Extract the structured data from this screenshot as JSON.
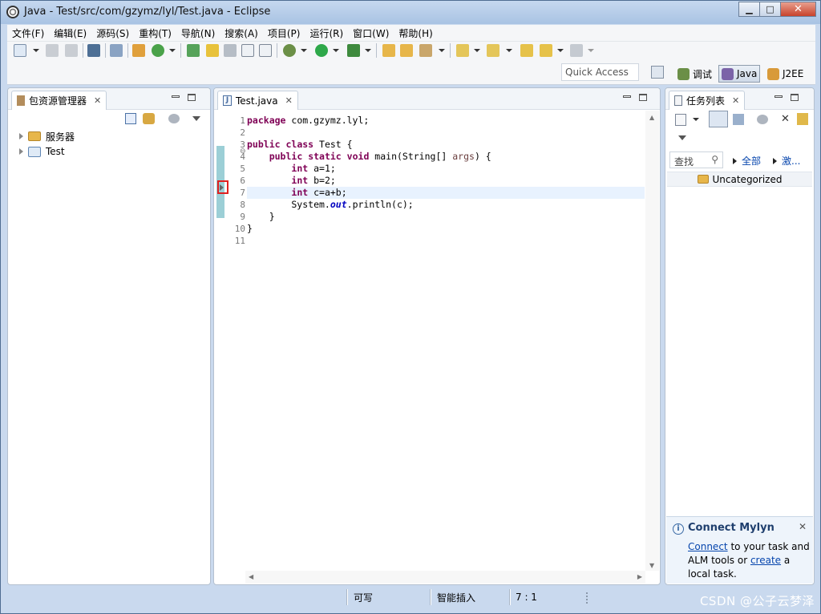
{
  "window": {
    "title": "Java - Test/src/com/gzymz/lyl/Test.java - Eclipse",
    "minimize": "▁",
    "maximize": "□",
    "close": "✕"
  },
  "menu": [
    "文件(F)",
    "编辑(E)",
    "源码(S)",
    "重构(T)",
    "导航(N)",
    "搜索(A)",
    "项目(P)",
    "运行(R)",
    "窗口(W)",
    "帮助(H)"
  ],
  "perspective": {
    "quick_access": "Quick Access",
    "items": [
      {
        "label": "调试",
        "icon": "debug-perspective-icon"
      },
      {
        "label": "Java",
        "icon": "java-perspective-icon",
        "active": true
      },
      {
        "label": "J2EE",
        "icon": "j2ee-perspective-icon"
      }
    ]
  },
  "package_explorer": {
    "tab_label": "包资源管理器",
    "close": "✕",
    "items": [
      {
        "label": "服务器",
        "icon": "folder-icon"
      },
      {
        "label": "Test",
        "icon": "project-icon"
      }
    ]
  },
  "editor": {
    "tab_label": "Test.java",
    "close": "✕",
    "line_numbers": [
      "1",
      "2",
      "3",
      "4",
      "5",
      "6",
      "7",
      "8",
      "9",
      "10",
      "11"
    ],
    "current_line": 7,
    "fold_marker": "⊖",
    "lines": [
      [],
      [
        {
          "t": "package",
          "c": "kw"
        },
        {
          "t": " com.gzymz.lyl;",
          "c": ""
        }
      ],
      [],
      [
        {
          "t": "public",
          "c": "kw"
        },
        {
          "t": " ",
          "c": ""
        },
        {
          "t": "class",
          "c": "kw"
        },
        {
          "t": " Test {",
          "c": ""
        }
      ],
      [
        {
          "t": "    ",
          "c": ""
        },
        {
          "t": "public",
          "c": "kw"
        },
        {
          "t": " ",
          "c": ""
        },
        {
          "t": "static",
          "c": "kw"
        },
        {
          "t": " ",
          "c": ""
        },
        {
          "t": "void",
          "c": "kw"
        },
        {
          "t": " main(String[] ",
          "c": ""
        },
        {
          "t": "args",
          "c": "param"
        },
        {
          "t": ") {",
          "c": ""
        }
      ],
      [
        {
          "t": "        ",
          "c": ""
        },
        {
          "t": "int",
          "c": "kw"
        },
        {
          "t": " a=1;",
          "c": ""
        }
      ],
      [
        {
          "t": "        ",
          "c": ""
        },
        {
          "t": "int",
          "c": "kw"
        },
        {
          "t": " b=2;",
          "c": ""
        }
      ],
      [
        {
          "t": "        ",
          "c": ""
        },
        {
          "t": "int",
          "c": "kw"
        },
        {
          "t": " c=a+b;",
          "c": ""
        }
      ],
      [
        {
          "t": "        System.",
          "c": ""
        },
        {
          "t": "out",
          "c": "static-field"
        },
        {
          "t": ".println(c);",
          "c": ""
        }
      ],
      [
        {
          "t": "    }",
          "c": ""
        }
      ],
      [
        {
          "t": "}",
          "c": ""
        }
      ],
      []
    ]
  },
  "task_list": {
    "tab_label": "任务列表",
    "close": "✕",
    "find_placeholder": "查找",
    "filter_all": "全部",
    "filter_activate": "激...",
    "category": "Uncategorized"
  },
  "mylyn": {
    "title": "Connect Mylyn",
    "close": "✕",
    "connect_link": "Connect",
    "text1": " to your task and",
    "text2": "ALM tools or ",
    "create_link": "create",
    "text3": " a",
    "text4": "local task."
  },
  "status": {
    "writable": "可写",
    "insert_mode": "智能插入",
    "position": "7 : 1"
  },
  "watermark": "CSDN @公子云梦泽",
  "colors": {
    "keyword": "#7f0055",
    "current_line": "#e8f2fe",
    "quickdiff": "#9ccfd6",
    "marker": "#e02020",
    "link": "#0000ee"
  }
}
